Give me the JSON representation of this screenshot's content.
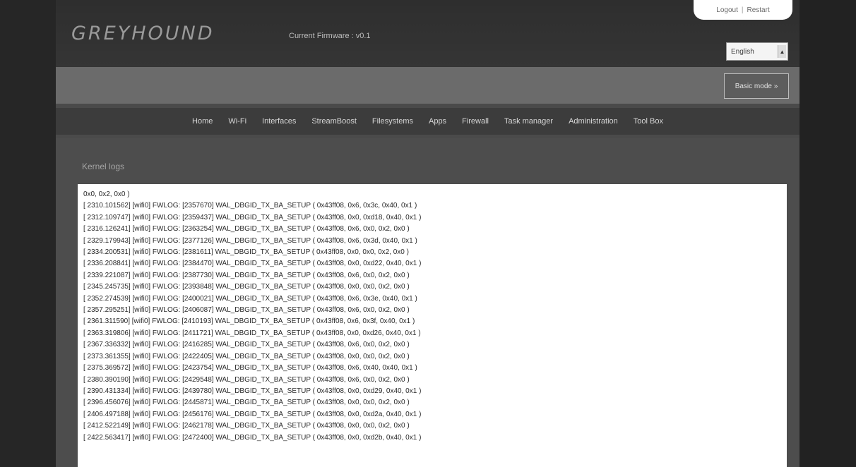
{
  "app": {
    "logo": "GREYHOUND",
    "firmware": "Current Firmware : v0.1"
  },
  "top_links": {
    "logout": "Logout",
    "restart": "Restart"
  },
  "language": {
    "selected": "English"
  },
  "mode_button": "Basic mode »",
  "nav": [
    "Home",
    "Wi-Fi",
    "Interfaces",
    "StreamBoost",
    "Filesystems",
    "Apps",
    "Firewall",
    "Task manager",
    "Administration",
    "Tool Box"
  ],
  "section_title": "Kernel logs",
  "log_lines": [
    "0x0, 0x2, 0x0 )",
    "[ 2310.101562] [wifi0] FWLOG: [2357670] WAL_DBGID_TX_BA_SETUP ( 0x43ff08, 0x6, 0x3c, 0x40, 0x1 )",
    "[ 2312.109747] [wifi0] FWLOG: [2359437] WAL_DBGID_TX_BA_SETUP ( 0x43ff08, 0x0, 0xd18, 0x40, 0x1 )",
    "[ 2316.126241] [wifi0] FWLOG: [2363254] WAL_DBGID_TX_BA_SETUP ( 0x43ff08, 0x6, 0x0, 0x2, 0x0 )",
    "[ 2329.179943] [wifi0] FWLOG: [2377126] WAL_DBGID_TX_BA_SETUP ( 0x43ff08, 0x6, 0x3d, 0x40, 0x1 )",
    "[ 2334.200531] [wifi0] FWLOG: [2381611] WAL_DBGID_TX_BA_SETUP ( 0x43ff08, 0x0, 0x0, 0x2, 0x0 )",
    "[ 2336.208841] [wifi0] FWLOG: [2384470] WAL_DBGID_TX_BA_SETUP ( 0x43ff08, 0x0, 0xd22, 0x40, 0x1 )",
    "[ 2339.221087] [wifi0] FWLOG: [2387730] WAL_DBGID_TX_BA_SETUP ( 0x43ff08, 0x6, 0x0, 0x2, 0x0 )",
    "[ 2345.245735] [wifi0] FWLOG: [2393848] WAL_DBGID_TX_BA_SETUP ( 0x43ff08, 0x0, 0x0, 0x2, 0x0 )",
    "[ 2352.274539] [wifi0] FWLOG: [2400021] WAL_DBGID_TX_BA_SETUP ( 0x43ff08, 0x6, 0x3e, 0x40, 0x1 )",
    "[ 2357.295251] [wifi0] FWLOG: [2406087] WAL_DBGID_TX_BA_SETUP ( 0x43ff08, 0x6, 0x0, 0x2, 0x0 )",
    "[ 2361.311590] [wifi0] FWLOG: [2410193] WAL_DBGID_TX_BA_SETUP ( 0x43ff08, 0x6, 0x3f, 0x40, 0x1 )",
    "[ 2363.319806] [wifi0] FWLOG: [2411721] WAL_DBGID_TX_BA_SETUP ( 0x43ff08, 0x0, 0xd26, 0x40, 0x1 )",
    "[ 2367.336332] [wifi0] FWLOG: [2416285] WAL_DBGID_TX_BA_SETUP ( 0x43ff08, 0x6, 0x0, 0x2, 0x0 )",
    "[ 2373.361355] [wifi0] FWLOG: [2422405] WAL_DBGID_TX_BA_SETUP ( 0x43ff08, 0x0, 0x0, 0x2, 0x0 )",
    "[ 2375.369572] [wifi0] FWLOG: [2423754] WAL_DBGID_TX_BA_SETUP ( 0x43ff08, 0x6, 0x40, 0x40, 0x1 )",
    "[ 2380.390190] [wifi0] FWLOG: [2429548] WAL_DBGID_TX_BA_SETUP ( 0x43ff08, 0x6, 0x0, 0x2, 0x0 )",
    "[ 2390.431334] [wifi0] FWLOG: [2439780] WAL_DBGID_TX_BA_SETUP ( 0x43ff08, 0x0, 0xd29, 0x40, 0x1 )",
    "[ 2396.456076] [wifi0] FWLOG: [2445871] WAL_DBGID_TX_BA_SETUP ( 0x43ff08, 0x0, 0x0, 0x2, 0x0 )",
    "[ 2406.497188] [wifi0] FWLOG: [2456176] WAL_DBGID_TX_BA_SETUP ( 0x43ff08, 0x0, 0xd2a, 0x40, 0x1 )",
    "[ 2412.522149] [wifi0] FWLOG: [2462178] WAL_DBGID_TX_BA_SETUP ( 0x43ff08, 0x0, 0x0, 0x2, 0x0 )",
    "[ 2422.563417] [wifi0] FWLOG: [2472400] WAL_DBGID_TX_BA_SETUP ( 0x43ff08, 0x0, 0xd2b, 0x40, 0x1 )"
  ]
}
